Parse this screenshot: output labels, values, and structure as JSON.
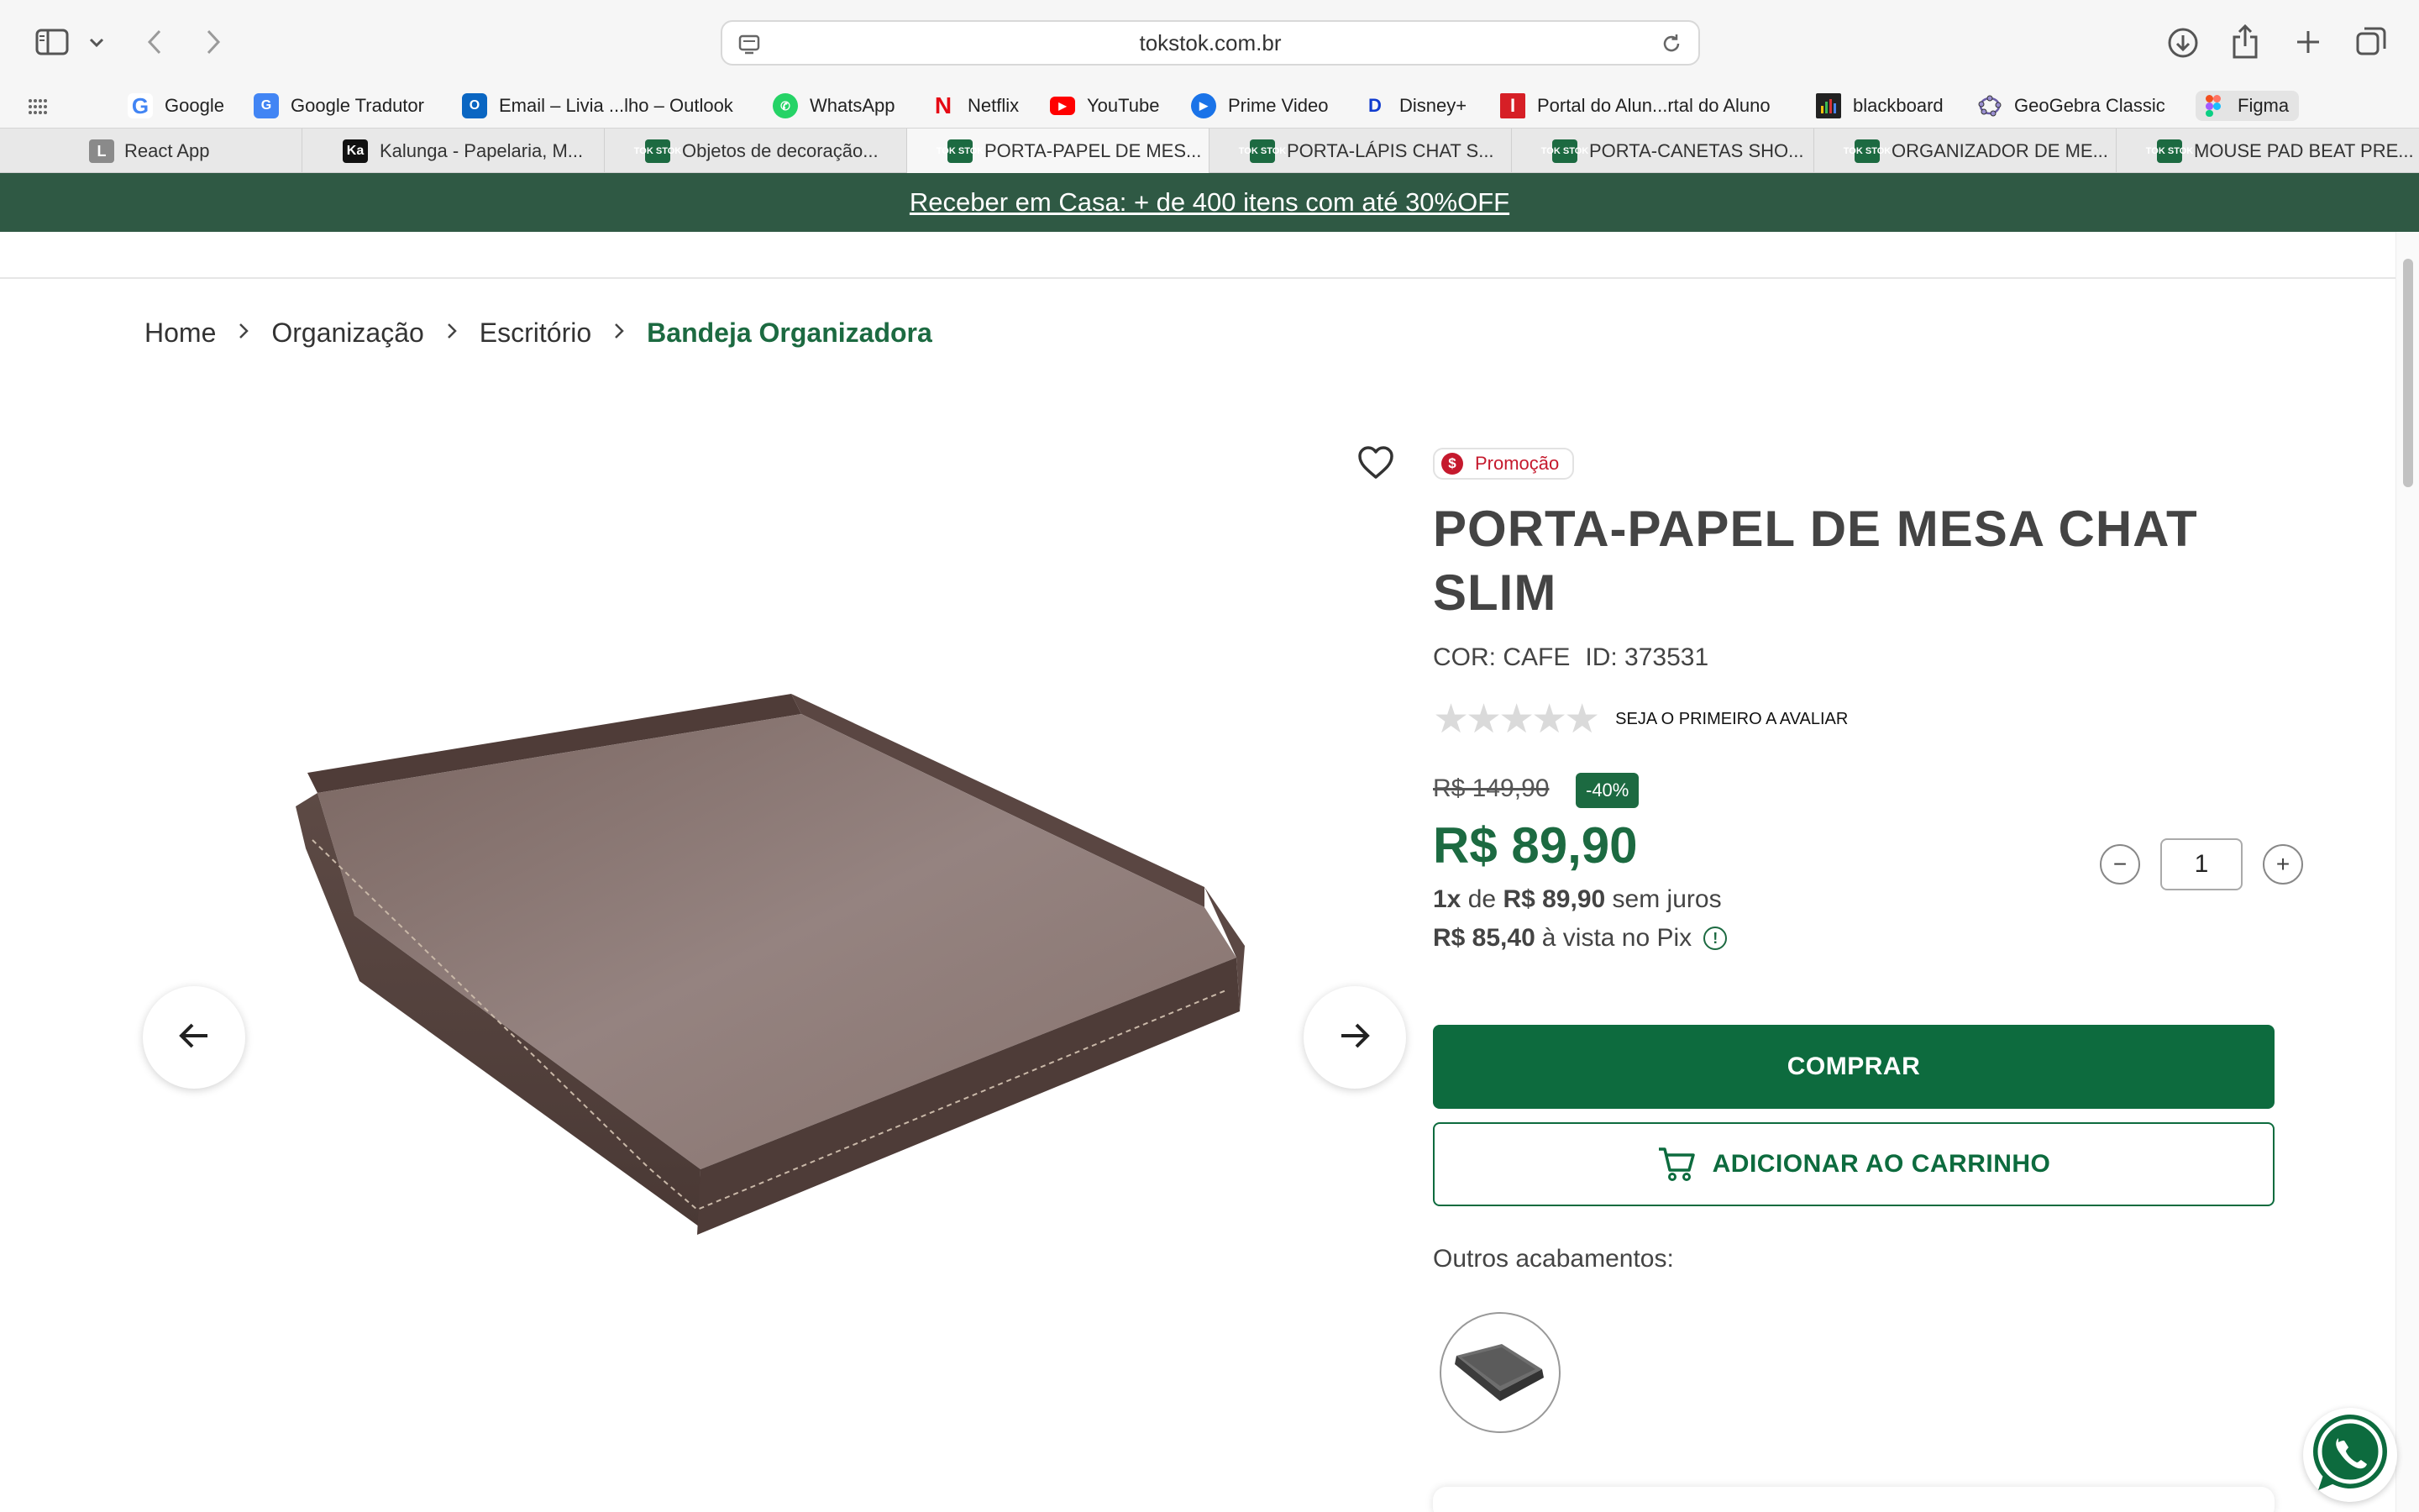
{
  "browser": {
    "url": "tokstok.com.br"
  },
  "bookmarks": [
    {
      "label": "Google",
      "icon": "google-icon",
      "color": "#4285f4"
    },
    {
      "label": "Google Tradutor",
      "icon": "translate-icon",
      "color": "#4285f4"
    },
    {
      "label": "Email – Livia ...lho – Outlook",
      "icon": "outlook-icon",
      "color": "#0a66c2"
    },
    {
      "label": "WhatsApp",
      "icon": "whatsapp-icon",
      "color": "#25d366"
    },
    {
      "label": "Netflix",
      "icon": "netflix-icon",
      "color": "#e50914"
    },
    {
      "label": "YouTube",
      "icon": "youtube-icon",
      "color": "#ff0000"
    },
    {
      "label": "Prime Video",
      "icon": "prime-video-icon",
      "color": "#1a73e8"
    },
    {
      "label": "Disney+",
      "icon": "disney-icon",
      "color": "#113ccf"
    },
    {
      "label": "Portal do Alun...rtal do Aluno",
      "icon": "portal-icon",
      "color": "#d61f26"
    },
    {
      "label": "blackboard",
      "icon": "blackboard-icon",
      "color": "#222222"
    },
    {
      "label": "GeoGebra Classic",
      "icon": "geogebra-icon",
      "color": "#6b5ea8"
    },
    {
      "label": "Figma",
      "icon": "figma-icon",
      "color": "#f24e1e"
    }
  ],
  "tabs": [
    {
      "label": "React App",
      "favicon": "L",
      "color": "#8a8a8a"
    },
    {
      "label": "Kalunga - Papelaria, M...",
      "favicon": "Ka",
      "color": "#111111"
    },
    {
      "label": "Objetos de decoração...",
      "favicon": "TOK STOK",
      "color": "#1c6a41"
    },
    {
      "label": "PORTA-PAPEL DE MES...",
      "favicon": "TOK STOK",
      "color": "#1c6a41",
      "active": true
    },
    {
      "label": "PORTA-LÁPIS CHAT S...",
      "favicon": "TOK STOK",
      "color": "#1c6a41"
    },
    {
      "label": "PORTA-CANETAS SHO...",
      "favicon": "TOK STOK",
      "color": "#1c6a41"
    },
    {
      "label": "ORGANIZADOR DE ME...",
      "favicon": "TOK STOK",
      "color": "#1c6a41"
    },
    {
      "label": "MOUSE PAD BEAT PRE...",
      "favicon": "TOK STOK",
      "color": "#1c6a41"
    }
  ],
  "promo": {
    "text": "Receber em Casa: + de 400 itens com até 30%OFF"
  },
  "breadcrumb": {
    "home": "Home",
    "level1": "Organização",
    "level2": "Escritório",
    "current": "Bandeja Organizadora"
  },
  "product": {
    "badge": "Promoção",
    "title": "PORTA-PAPEL DE MESA CHAT SLIM",
    "color_label": "COR: CAFE",
    "id_label": "ID: 373531",
    "rating_text": "SEJA O PRIMEIRO A AVALIAR",
    "rating_value": 0,
    "rating_max": 5,
    "old_price": "R$ 149,90",
    "discount": "-40%",
    "price": "R$ 89,90",
    "installments_count": "1x",
    "installments_mid": "de",
    "installments_value": "R$ 89,90",
    "installments_suffix": "sem juros",
    "pix_price": "R$ 85,40",
    "pix_suffix": "à vista no Pix",
    "quantity": "1",
    "quantity_minus": "−",
    "quantity_plus": "+",
    "buy_label": "COMPRAR",
    "cart_label": "ADICIONAR AO CARRINHO",
    "finishes_label": "Outros acabamentos:"
  },
  "colors": {
    "brand_green": "#1c6a41",
    "promo_bar": "#2f5944",
    "promo_red": "#c5192d"
  }
}
